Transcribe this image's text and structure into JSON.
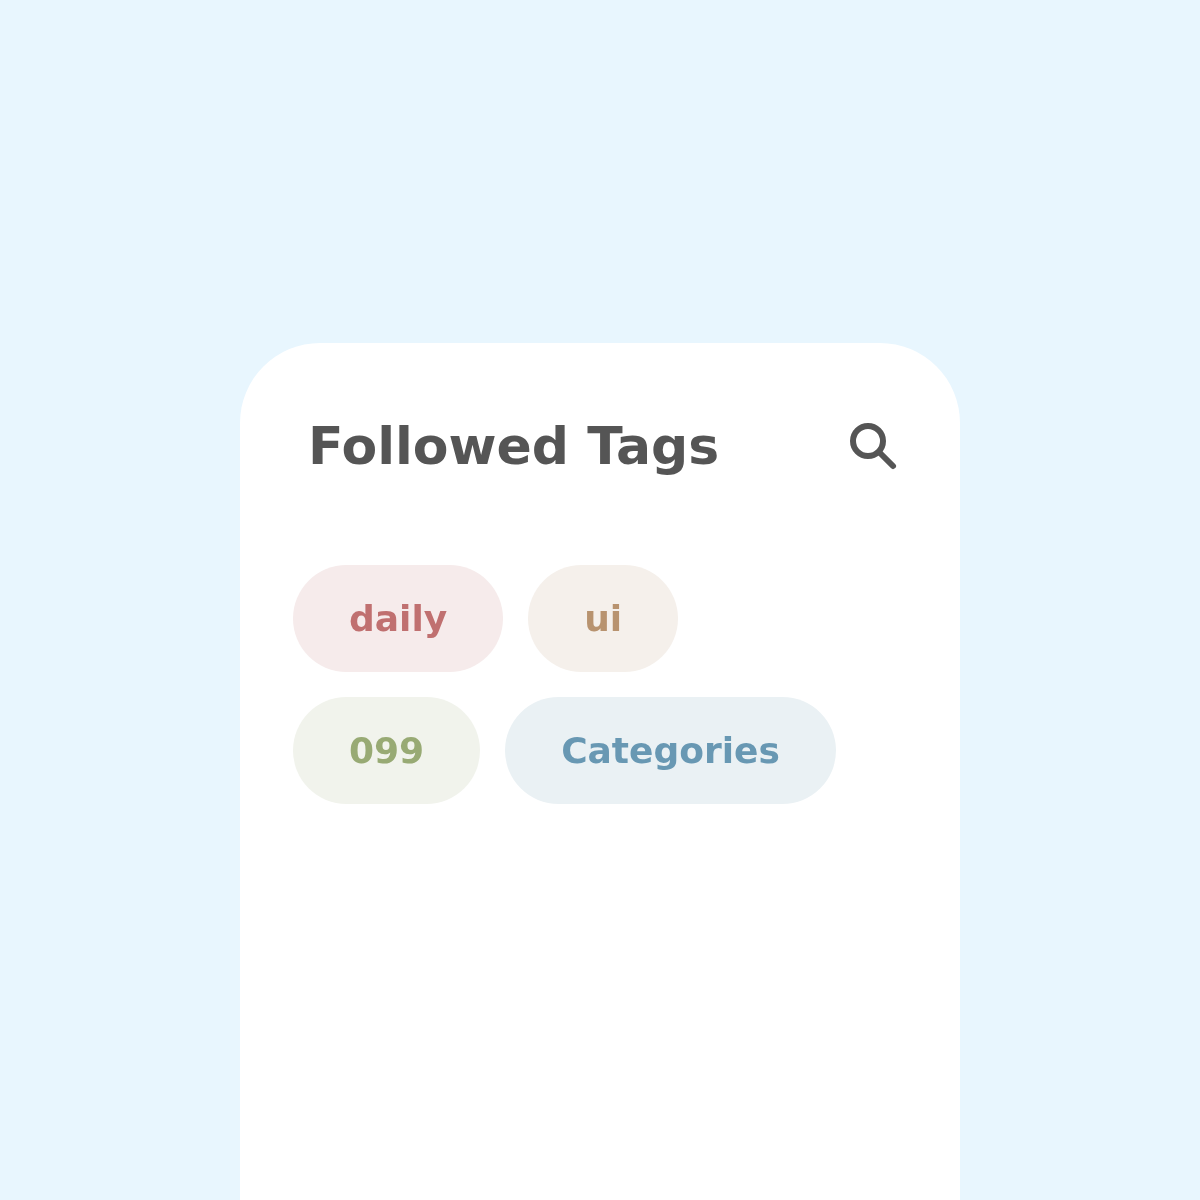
{
  "header": {
    "title": "Followed Tags"
  },
  "tags": [
    {
      "label": "daily",
      "color": "#c07070"
    },
    {
      "label": "ui",
      "color": "#b8936f"
    },
    {
      "label": "099",
      "color": "#98aa74"
    },
    {
      "label": "Categories",
      "color": "#6898b3"
    }
  ]
}
